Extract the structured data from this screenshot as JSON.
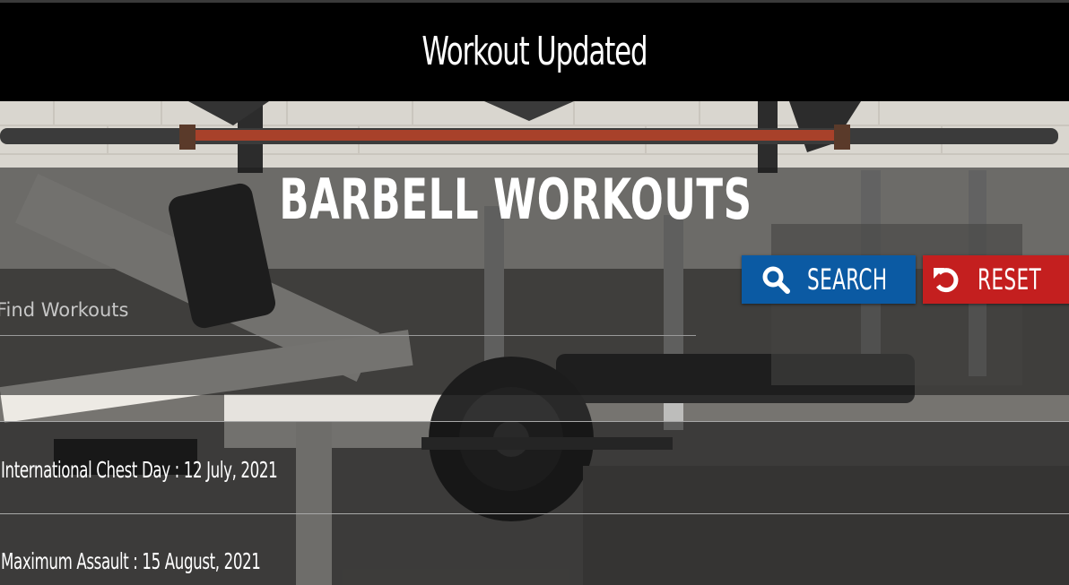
{
  "header": {
    "title": "Workout Updated"
  },
  "page": {
    "title": "BARBELL WORKOUTS"
  },
  "search": {
    "placeholder": "Find Workouts",
    "value": "",
    "search_label": "SEARCH",
    "search_icon": "search-icon",
    "reset_label": "RESET",
    "reset_icon": "reset-icon"
  },
  "workouts": [
    {
      "label": "International Chest Day : 12 July, 2021"
    },
    {
      "label": "Maximum Assault : 15 August, 2021"
    }
  ],
  "colors": {
    "search_button": "#0b5aa3",
    "reset_button": "#c41f1f",
    "banner": "#000000",
    "text": "#ffffff"
  }
}
